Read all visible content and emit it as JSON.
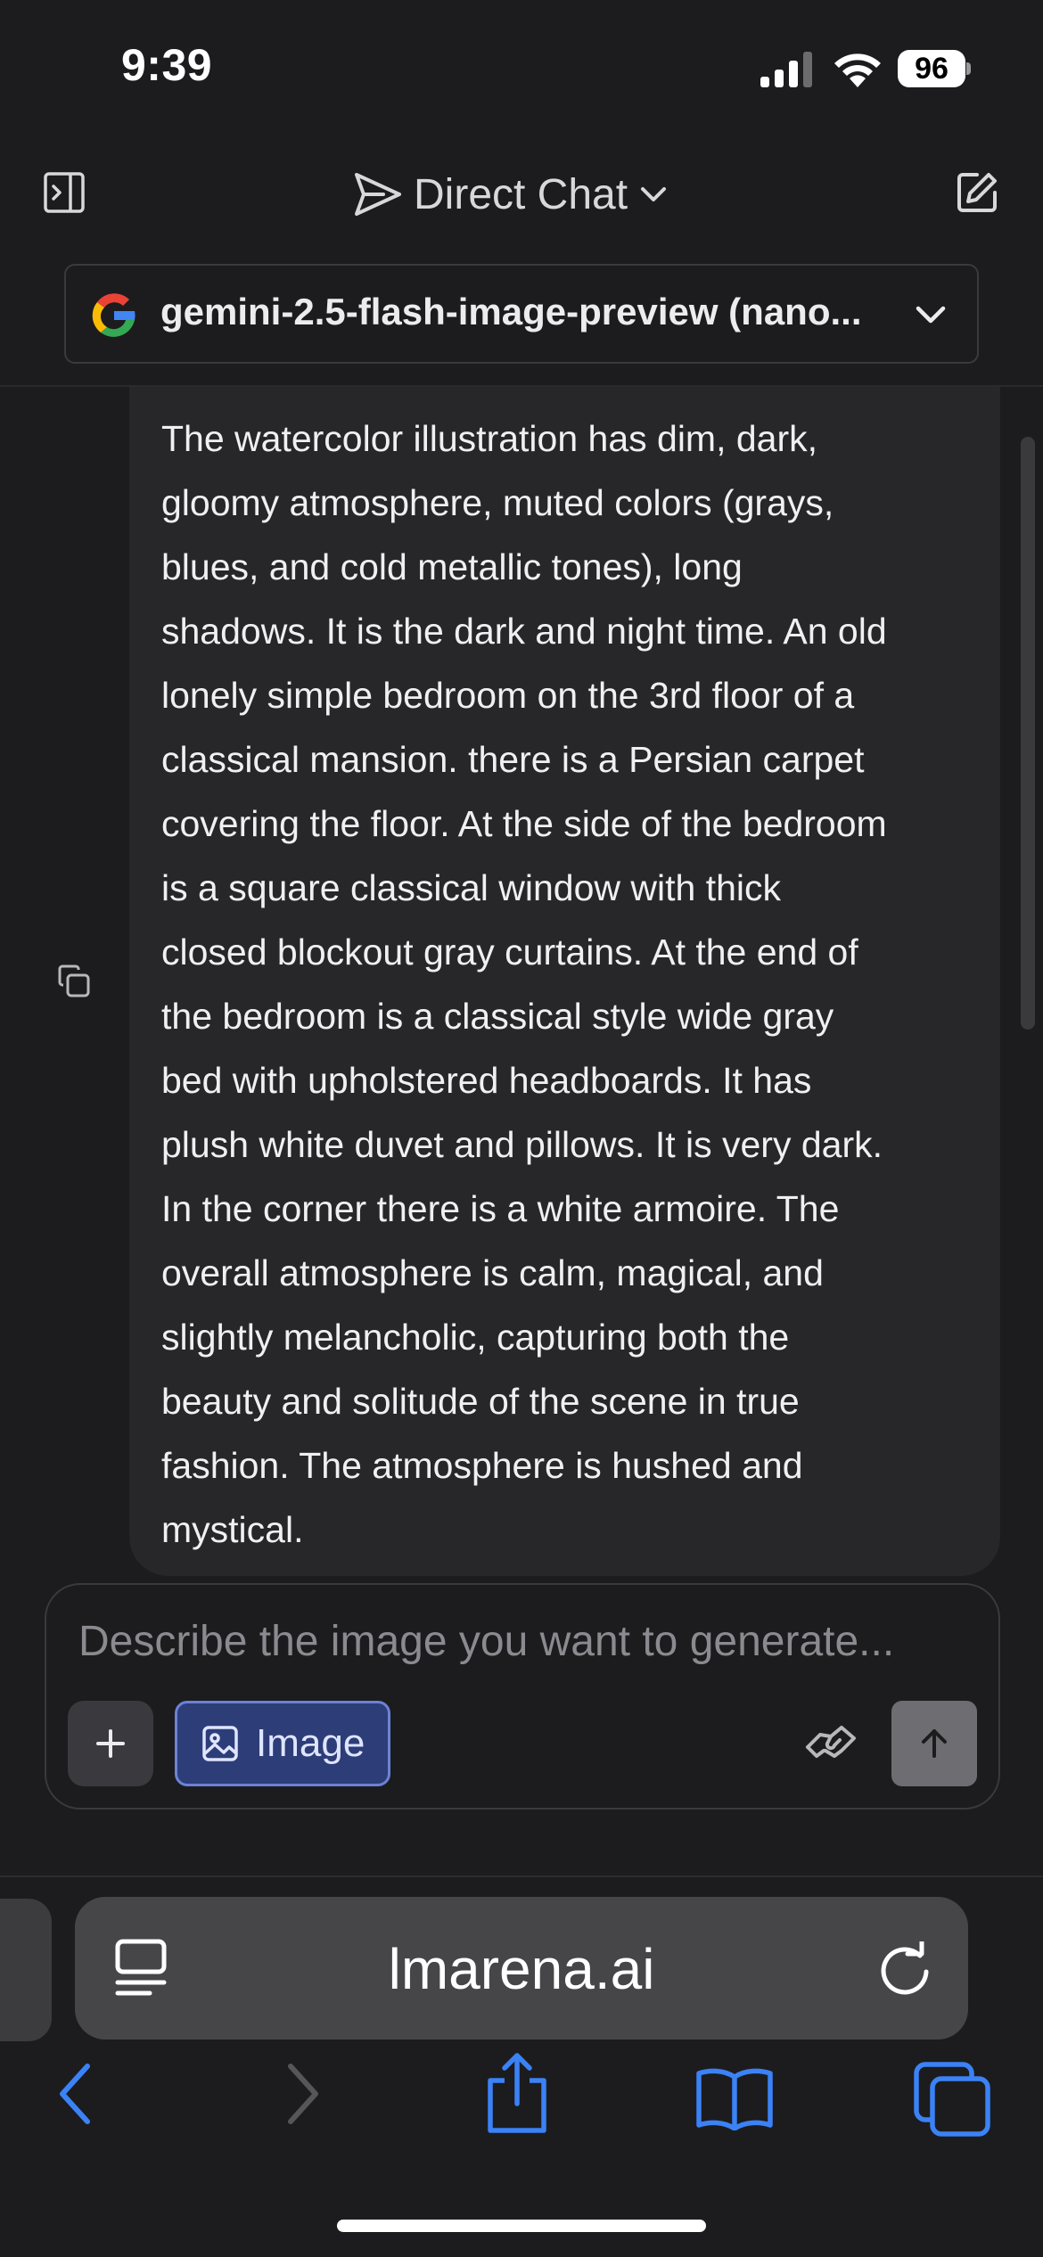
{
  "status_bar": {
    "time": "9:39",
    "battery": "96"
  },
  "header": {
    "title": "Direct Chat"
  },
  "model_selector": {
    "model_name": "gemini-2.5-flash-image-preview (nano..."
  },
  "message": {
    "lines": [
      "The watercolor illustration has dim, dark,",
      "gloomy atmosphere, muted colors (grays,",
      "blues, and cold metallic tones), long",
      "shadows. It is the dark and night time. An old",
      "lonely simple bedroom on the 3rd floor of a",
      "classical mansion. there is a Persian carpet",
      "covering the floor. At the side of the bedroom",
      "is a square classical window with thick",
      "closed blockout gray curtains. At the end of",
      "the bedroom is a classical style wide gray",
      "bed with upholstered headboards. It has",
      "plush white duvet and pillows. It is very dark.",
      "In the corner there is a white armoire. The",
      "overall atmosphere is calm, magical, and",
      "slightly melancholic, capturing both the",
      "beauty and solitude of the scene in true",
      "fashion. The atmosphere is hushed and",
      "mystical."
    ]
  },
  "composer": {
    "placeholder": "Describe the image you want to generate...",
    "image_button_label": "Image"
  },
  "browser": {
    "url": "lmarena.ai"
  },
  "icons": {
    "sidebar": "sidebar-toggle-icon",
    "send_plane": "paper-plane-icon",
    "edit": "edit-icon",
    "copy": "copy-icon",
    "add": "plus-icon",
    "image": "image-icon",
    "handshake": "handshake-icon",
    "send": "arrow-up-icon",
    "reader": "reader-mode-icon",
    "reload": "reload-icon",
    "back": "back-icon",
    "forward": "forward-icon",
    "share": "share-icon",
    "bookmarks": "bookmarks-icon",
    "tabs": "tabs-icon"
  },
  "colors": {
    "background": "#1c1c1e",
    "bubble": "#272729",
    "accent": "#3b82f6",
    "image_button": "#2d3d78"
  }
}
